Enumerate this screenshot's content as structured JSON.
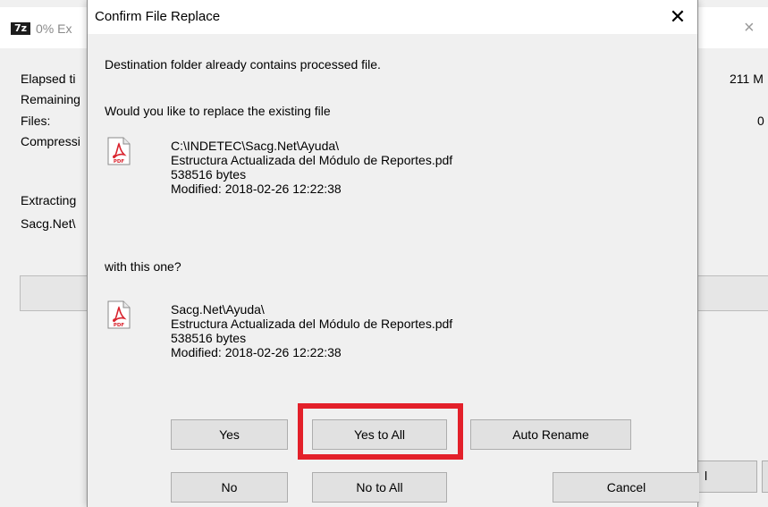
{
  "background_window": {
    "app_icon": "7z",
    "title": "0% Ex",
    "close_glyph": "×",
    "labels": [
      "Elapsed ti",
      "Remaining",
      "Files:",
      "Compressi",
      "Extracting",
      "Sacg.Net\\"
    ],
    "right_values": [
      "211 M",
      "0"
    ],
    "partial_button_label": "l"
  },
  "dialog": {
    "title": "Confirm File Replace",
    "close_glyph": "✕",
    "message": "Destination folder already contains processed file.",
    "question_existing": "Would you like to replace the existing file",
    "existing_file": {
      "path": "C:\\INDETEC\\Sacg.Net\\Ayuda\\",
      "name": "Estructura Actualizada del Módulo de Reportes.pdf",
      "size": "538516 bytes",
      "modified": "Modified: 2018-02-26 12:22:38"
    },
    "question_new": "with this one?",
    "new_file": {
      "path": "Sacg.Net\\Ayuda\\",
      "name": "Estructura Actualizada del Módulo de Reportes.pdf",
      "size": "538516 bytes",
      "modified": "Modified: 2018-02-26 12:22:38"
    },
    "buttons": {
      "yes": "Yes",
      "yes_to_all": "Yes to All",
      "auto_rename": "Auto Rename",
      "no": "No",
      "no_to_all": "No to All",
      "cancel": "Cancel"
    },
    "pdf_icon_text": "PDF"
  },
  "colors": {
    "highlight": "#e3202a",
    "pdf_red": "#d9232d"
  }
}
